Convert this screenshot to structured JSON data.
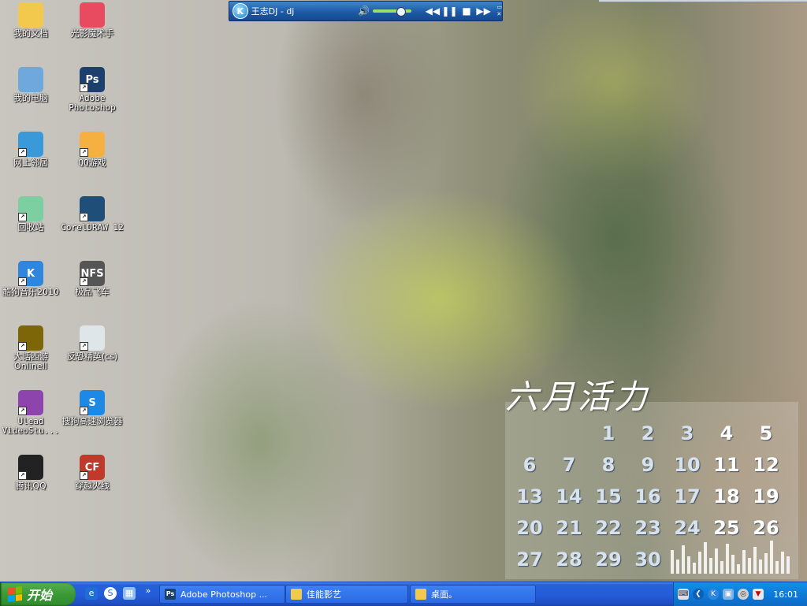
{
  "desktop": {
    "icons": [
      {
        "label": "我的文档",
        "icon": "folder-documents-icon",
        "color": "#f2c94c"
      },
      {
        "label": "光影魔术手",
        "icon": "photo-app-icon",
        "color": "#e84a5f"
      },
      {
        "label": "我的电脑",
        "icon": "computer-icon",
        "color": "#6fa8dc"
      },
      {
        "label": "Adobe Photoshop",
        "icon": "photoshop-icon",
        "color": "#1c3f6e",
        "glyph": "Ps"
      },
      {
        "label": "网上邻居",
        "icon": "network-icon",
        "color": "#3a9ad9"
      },
      {
        "label": "QQ游戏",
        "icon": "qq-game-icon",
        "color": "#f5b041"
      },
      {
        "label": "回收站",
        "icon": "recycle-bin-icon",
        "color": "#7dcea0"
      },
      {
        "label": "CorelDRAW 12",
        "icon": "coreldraw-icon",
        "color": "#1f4e79"
      },
      {
        "label": "酷狗音乐2010",
        "icon": "kugou-icon",
        "color": "#2e86de",
        "glyph": "K"
      },
      {
        "label": "极品飞车",
        "icon": "nfs-icon",
        "color": "#555555",
        "glyph": "NFS"
      },
      {
        "label": "大话西游OnlineII",
        "icon": "dahua-icon",
        "color": "#7d6608"
      },
      {
        "label": "反恐精英(cs)",
        "icon": "counter-strike-icon",
        "color": "#dfe6e9"
      },
      {
        "label": "Ulead VideoStu...",
        "icon": "ulead-icon",
        "color": "#8e44ad"
      },
      {
        "label": "搜狗高速浏览器",
        "icon": "sogou-browser-icon",
        "color": "#1e88e5",
        "glyph": "S"
      },
      {
        "label": "腾讯QQ",
        "icon": "qq-penguin-icon",
        "color": "#222222"
      },
      {
        "label": "穿越火线",
        "icon": "crossfire-icon",
        "color": "#c0392b",
        "glyph": "CF"
      }
    ]
  },
  "player": {
    "logo_glyph": "K",
    "title": "王志DJ - dj",
    "volume_icon": "volume-icon",
    "volume_level": 0.7,
    "controls": [
      "◀◀",
      "❚❚",
      "■",
      "▶▶"
    ]
  },
  "calendar": {
    "title": "六月活力",
    "rows": [
      [
        "",
        "",
        "1",
        "2",
        "3",
        "4",
        "5"
      ],
      [
        "6",
        "7",
        "8",
        "9",
        "10",
        "11",
        "12"
      ],
      [
        "13",
        "14",
        "15",
        "16",
        "17",
        "18",
        "19"
      ],
      [
        "20",
        "21",
        "22",
        "23",
        "24",
        "25",
        "26"
      ],
      [
        "27",
        "28",
        "29",
        "30",
        "",
        "",
        ""
      ]
    ]
  },
  "taskbar": {
    "start_label": "开始",
    "quick_launch": [
      "ie-icon",
      "sogou-icon",
      "show-desktop-icon"
    ],
    "chevron": "»",
    "tasks": [
      {
        "label": "Adobe Photoshop ...",
        "icon": "photoshop-icon",
        "glyph": "Ps"
      },
      {
        "label": "佳能影艺",
        "icon": "folder-icon",
        "glyph": ""
      },
      {
        "label": "桌面。",
        "icon": "folder-icon",
        "glyph": ""
      }
    ],
    "tray": {
      "icons": [
        "keyboard-icon",
        "chevron-left-icon",
        "kugou-tray-icon",
        "network-tray-icon",
        "security-tray-icon",
        "shield-tray-icon"
      ],
      "clock": "16:01"
    }
  },
  "colors": {
    "taskbar_blue": "#245ddb",
    "start_green": "#3c9a37",
    "tray_blue": "#0f7ad8"
  }
}
